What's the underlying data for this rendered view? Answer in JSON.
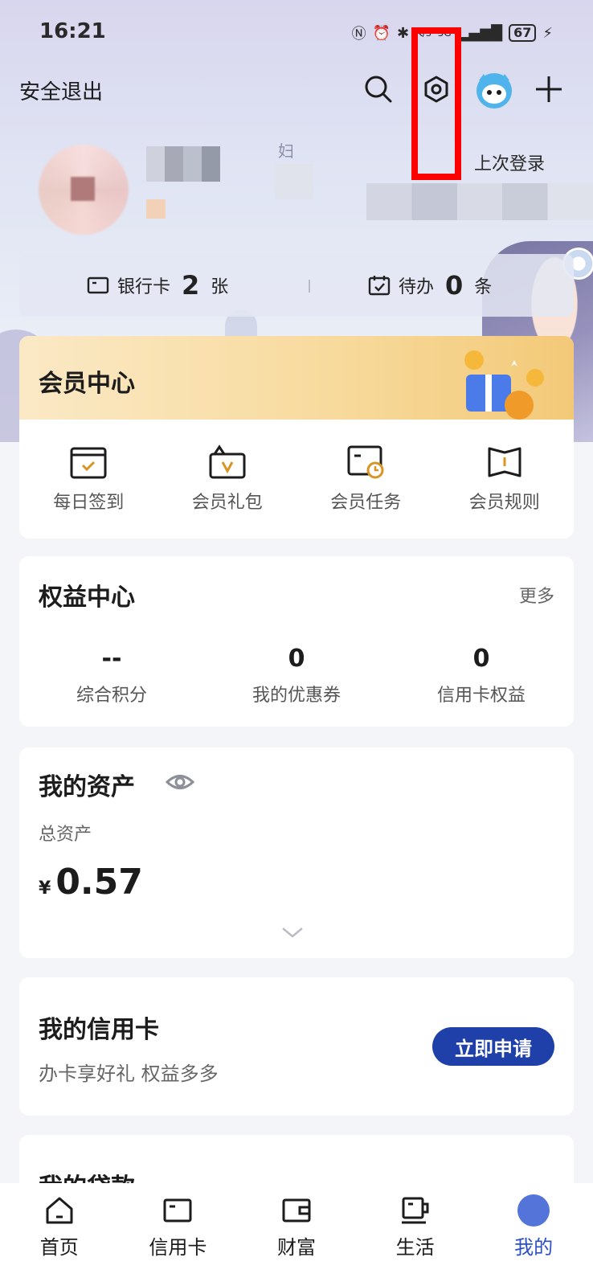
{
  "status_bar": {
    "time": "16:21",
    "net_speed": "K/s",
    "signal": "5G",
    "battery": "67"
  },
  "topbar": {
    "logout_label": "安全退出"
  },
  "profile": {
    "small_char": "妇",
    "last_login_label": "上次登录"
  },
  "summary": {
    "bank_card_label": "银行卡",
    "bank_card_count": "2",
    "bank_card_unit": "张",
    "todo_label": "待办",
    "todo_count": "0",
    "todo_unit": "条"
  },
  "member_center": {
    "title": "会员中心",
    "items": [
      {
        "label": "每日签到",
        "icon": "calendar-check-icon"
      },
      {
        "label": "会员礼包",
        "icon": "gift-bag-icon"
      },
      {
        "label": "会员任务",
        "icon": "task-clock-icon"
      },
      {
        "label": "会员规则",
        "icon": "rules-book-icon"
      }
    ]
  },
  "rights_center": {
    "title": "权益中心",
    "more_label": "更多",
    "items": [
      {
        "value": "--",
        "label": "综合积分"
      },
      {
        "value": "0",
        "label": "我的优惠券"
      },
      {
        "value": "0",
        "label": "信用卡权益"
      }
    ]
  },
  "assets": {
    "title": "我的资产",
    "subtitle": "总资产",
    "currency": "¥",
    "amount": "0.57"
  },
  "credit_card": {
    "title": "我的信用卡",
    "subtitle": "办卡享好礼 权益多多",
    "apply_label": "立即申请"
  },
  "loan": {
    "title": "我的贷款"
  },
  "tabbar": {
    "items": [
      {
        "label": "首页",
        "icon": "home-icon"
      },
      {
        "label": "信用卡",
        "icon": "card-icon"
      },
      {
        "label": "财富",
        "icon": "wallet-icon"
      },
      {
        "label": "生活",
        "icon": "cup-icon"
      },
      {
        "label": "我的",
        "icon": "profile-icon"
      }
    ]
  },
  "colors": {
    "accent": "#1f40a8",
    "highlight": "#ff0000",
    "tab_active": "#2b4fc7"
  }
}
